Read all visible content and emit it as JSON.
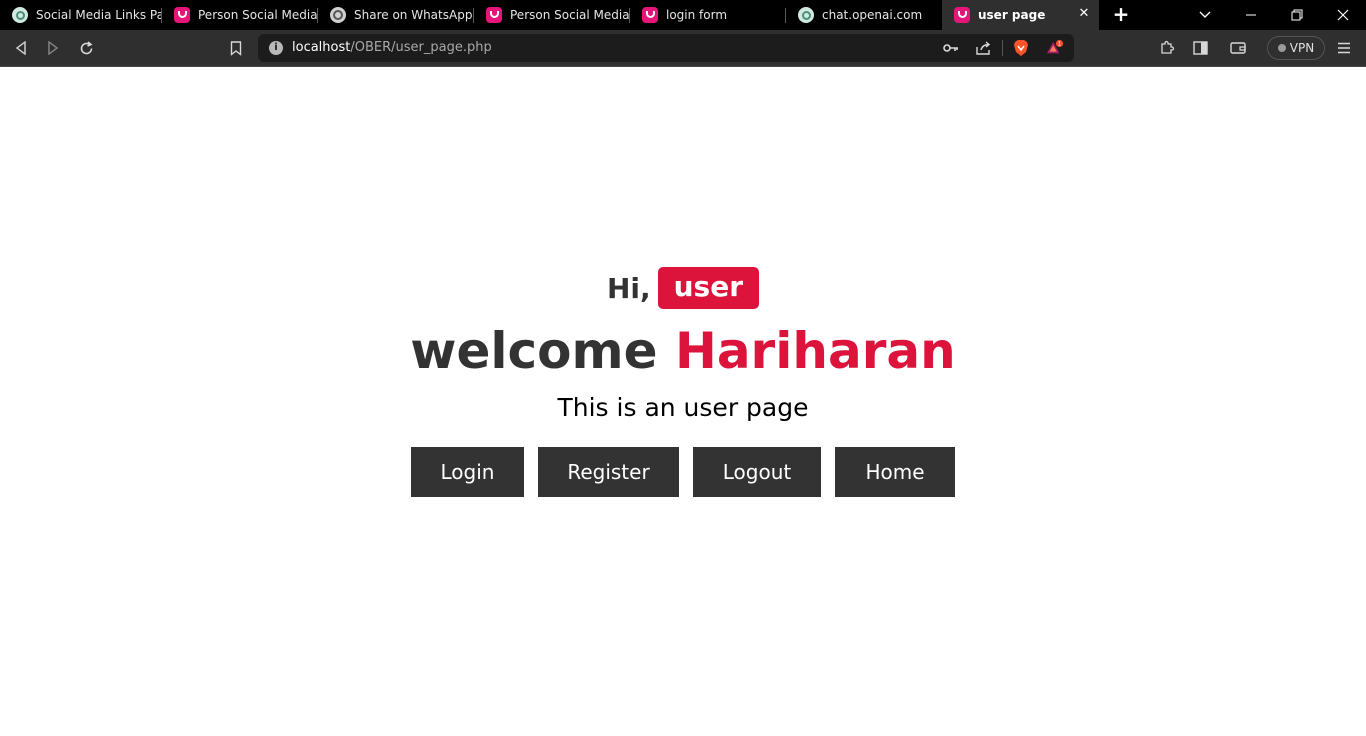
{
  "browser": {
    "tabs": [
      {
        "title": "Social Media Links Pag",
        "favicon": "openai-icon",
        "active": false
      },
      {
        "title": "Person Social Media Li",
        "favicon": "pink-app-icon",
        "active": false
      },
      {
        "title": "Share on WhatsApp",
        "favicon": "globe-icon",
        "active": false
      },
      {
        "title": "Person Social Media Li",
        "favicon": "pink-app-icon",
        "active": false
      },
      {
        "title": "login form",
        "favicon": "pink-app-icon",
        "active": false
      },
      {
        "title": "chat.openai.com",
        "favicon": "openai-icon",
        "active": false
      },
      {
        "title": "user page",
        "favicon": "pink-app-icon",
        "active": true
      }
    ],
    "address": {
      "host": "localhost",
      "path": "/OBER/user_page.php"
    },
    "vpn_label": "VPN",
    "colors": {
      "tabbar": "#000000",
      "toolbar": "#2f2f2f",
      "active_tab": "#2f2f2f"
    }
  },
  "page": {
    "greeting": "Hi,",
    "role_badge": "user",
    "welcome_word": "welcome",
    "user_name": "Hariharan",
    "subtitle": "This is an user page",
    "buttons": {
      "login": "Login",
      "register": "Register",
      "logout": "Logout",
      "home": "Home"
    },
    "colors": {
      "accent": "#dc143c",
      "text": "#333333",
      "button_bg": "#333333",
      "button_text": "#ffffff"
    }
  }
}
